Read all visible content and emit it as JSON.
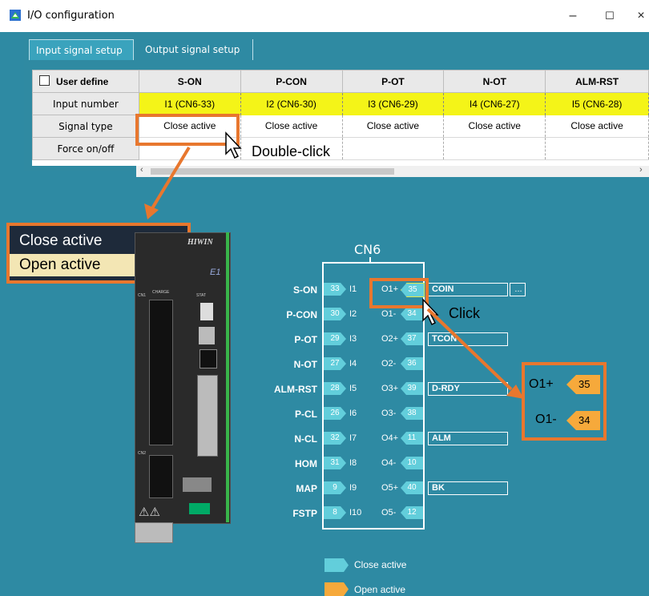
{
  "window": {
    "title": "I/O configuration",
    "minimize": "–",
    "maximize": "☐",
    "close": "×"
  },
  "tabs": [
    {
      "label": "Input signal setup"
    },
    {
      "label": "Output signal setup"
    }
  ],
  "grid": {
    "user_define": "User define",
    "columns": [
      "S-ON",
      "P-CON",
      "P-OT",
      "N-OT",
      "ALM-RST"
    ],
    "rows": {
      "input_number": {
        "label": "Input number",
        "values": [
          "I1 (CN6-33)",
          "I2 (CN6-30)",
          "I3 (CN6-29)",
          "I4 (CN6-27)",
          "I5 (CN6-28)"
        ]
      },
      "signal_type": {
        "label": "Signal type",
        "values": [
          "Close active",
          "Close active",
          "Close active",
          "Close active",
          "Close active"
        ]
      },
      "force": {
        "label": "Force on/off"
      }
    }
  },
  "annotations": {
    "double_click": "Double-click",
    "click": "Click"
  },
  "popup": {
    "items": [
      "Close active",
      "Open active"
    ]
  },
  "drive": {
    "brand": "HIWIN",
    "model": "E1",
    "charge": "CHARGE",
    "cn1": "CN1",
    "cn2": "CN2",
    "stat": "STAT"
  },
  "cn6": {
    "title": "CN6",
    "inputs": [
      {
        "name": "S-ON",
        "pin": "33",
        "io": "I1"
      },
      {
        "name": "P-CON",
        "pin": "30",
        "io": "I2"
      },
      {
        "name": "P-OT",
        "pin": "29",
        "io": "I3"
      },
      {
        "name": "N-OT",
        "pin": "27",
        "io": "I4"
      },
      {
        "name": "ALM-RST",
        "pin": "28",
        "io": "I5"
      },
      {
        "name": "P-CL",
        "pin": "26",
        "io": "I6"
      },
      {
        "name": "N-CL",
        "pin": "32",
        "io": "I7"
      },
      {
        "name": "HOM",
        "pin": "31",
        "io": "I8"
      },
      {
        "name": "MAP",
        "pin": "9",
        "io": "I9"
      },
      {
        "name": "FSTP",
        "pin": "8",
        "io": "I10"
      }
    ],
    "outputs": [
      {
        "io": "O1+",
        "pin": "35",
        "signal": "COIN"
      },
      {
        "io": "O1-",
        "pin": "34"
      },
      {
        "io": "O2+",
        "pin": "37",
        "signal": "TCON"
      },
      {
        "io": "O2-",
        "pin": "36"
      },
      {
        "io": "O3+",
        "pin": "39",
        "signal": "D-RDY"
      },
      {
        "io": "O3-",
        "pin": "38"
      },
      {
        "io": "O4+",
        "pin": "11",
        "signal": "ALM"
      },
      {
        "io": "O4-",
        "pin": "10"
      },
      {
        "io": "O5+",
        "pin": "40",
        "signal": "BK"
      },
      {
        "io": "O5-",
        "pin": "12"
      }
    ],
    "more_button": "..."
  },
  "zoom": {
    "o1p": "O1+",
    "p35": "35",
    "o1m": "O1-",
    "p34": "34"
  },
  "legend": {
    "close": "Close active",
    "open": "Open active"
  },
  "colors": {
    "close_active": "#62cedb",
    "open_active": "#f6a93b",
    "callout": "#e8772e",
    "highlight": "#f4f418"
  }
}
